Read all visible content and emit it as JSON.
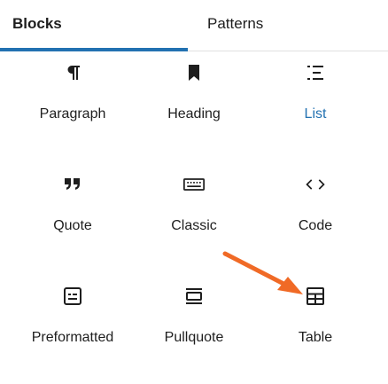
{
  "tabs": {
    "blocks": "Blocks",
    "patterns": "Patterns"
  },
  "blocks": [
    {
      "label": "Paragraph",
      "icon": "paragraph-icon"
    },
    {
      "label": "Heading",
      "icon": "bookmark-icon"
    },
    {
      "label": "List",
      "icon": "list-icon"
    },
    {
      "label": "Quote",
      "icon": "quote-icon"
    },
    {
      "label": "Classic",
      "icon": "keyboard-icon"
    },
    {
      "label": "Code",
      "icon": "code-icon"
    },
    {
      "label": "Preformatted",
      "icon": "preformatted-icon"
    },
    {
      "label": "Pullquote",
      "icon": "pullquote-icon"
    },
    {
      "label": "Table",
      "icon": "table-icon"
    }
  ],
  "colors": {
    "accent": "#2271b1",
    "arrow": "#f06a26",
    "text": "#1e1e1e"
  }
}
